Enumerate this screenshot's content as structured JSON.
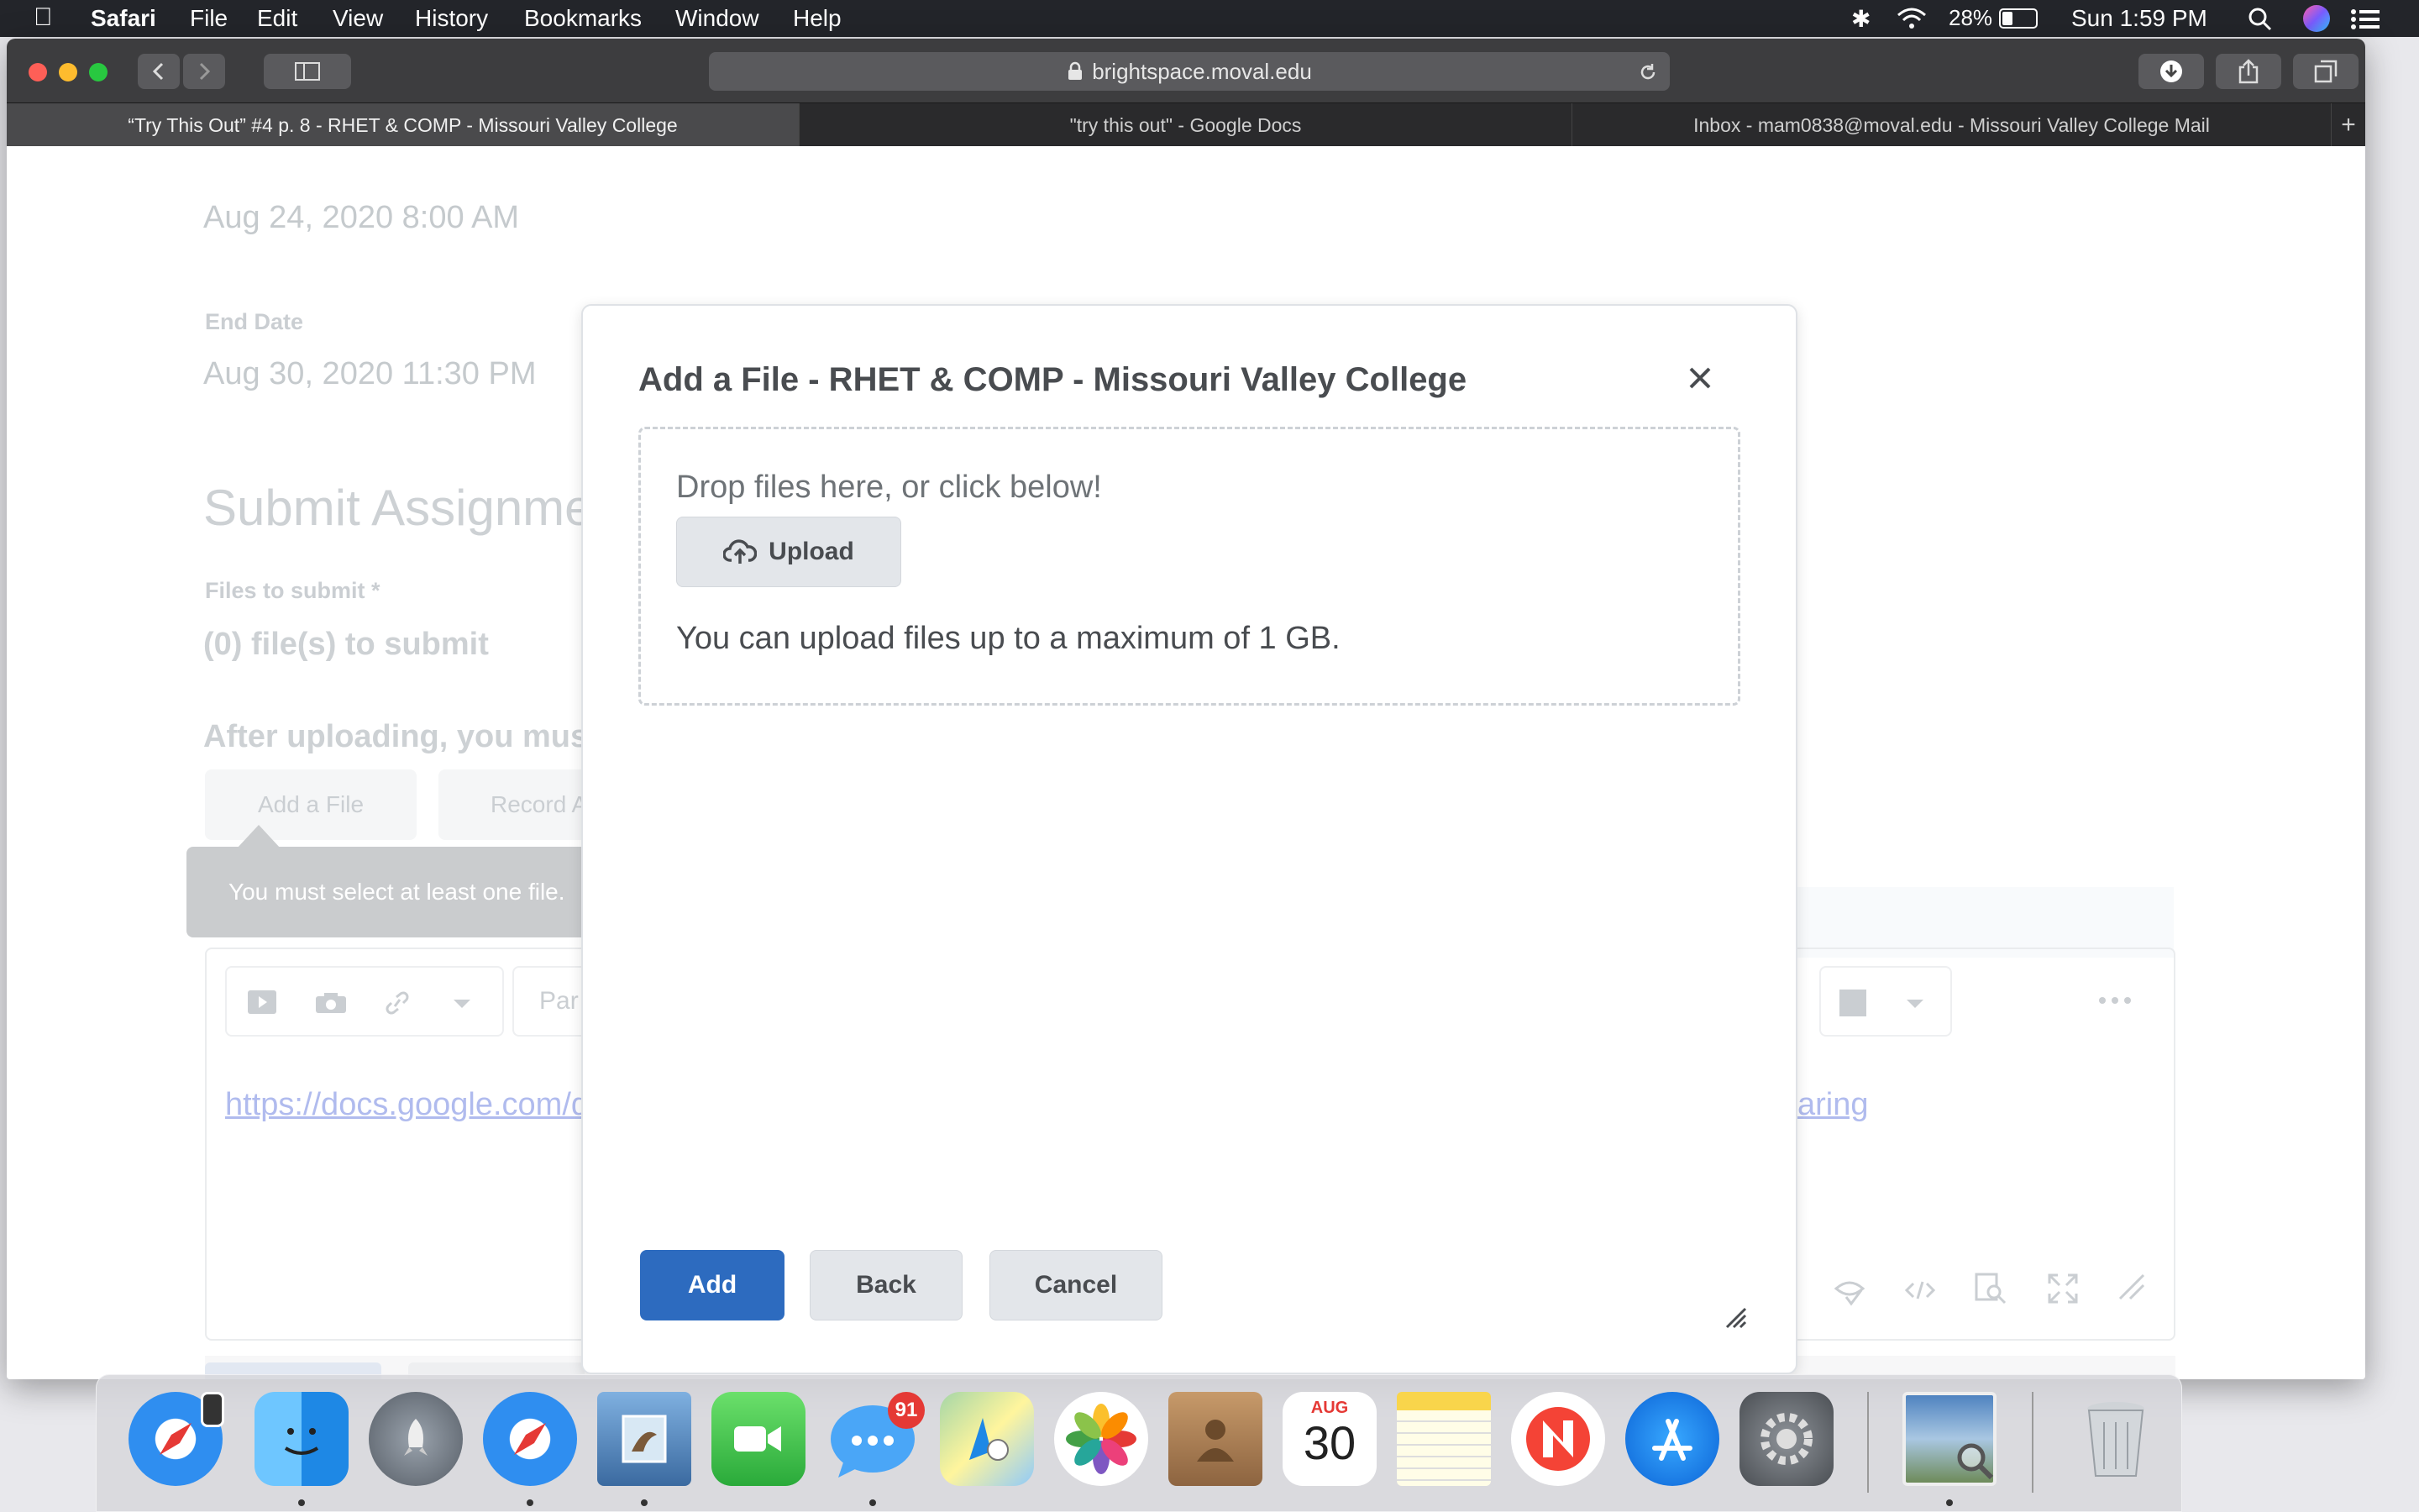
{
  "menubar": {
    "app_name": "Safari",
    "items": [
      "File",
      "Edit",
      "View",
      "History",
      "Bookmarks",
      "Window",
      "Help"
    ],
    "battery": "28%",
    "clock": "Sun 1:59 PM"
  },
  "browser": {
    "url": "brightspace.moval.edu",
    "tabs": [
      {
        "title": "“Try This Out” #4 p. 8 - RHET & COMP - Missouri Valley College"
      },
      {
        "title": "\"try this out\" - Google Docs"
      },
      {
        "title": "Inbox - mam0838@moval.edu - Missouri Valley College Mail"
      }
    ],
    "new_tab": "+"
  },
  "page": {
    "start_date": "Aug 24, 2020 8:00 AM",
    "end_date_label": "End Date",
    "end_date": "Aug 30, 2020 11:30 PM",
    "section_heading": "Submit Assignme",
    "files_label": "Files to submit *",
    "files_count": "(0) file(s) to submit",
    "after_upload": "After uploading, you must",
    "add_file_button": "Add a File",
    "record_button": "Record A",
    "tooltip": "You must select at least one file.",
    "editor_format_placeholder": "Par",
    "link_left": "https://docs.google.com/d",
    "link_right": "aring"
  },
  "modal": {
    "title": "Add a File - RHET & COMP - Missouri Valley College",
    "drop_text": "Drop files here, or click below!",
    "upload_label": "Upload",
    "limit_text": "You can upload files up to a maximum of 1 GB.",
    "add_label": "Add",
    "back_label": "Back",
    "cancel_label": "Cancel"
  },
  "dock": {
    "messages_badge": "91",
    "calendar_month": "AUG",
    "calendar_day": "30"
  },
  "colors": {
    "primary_button": "#2d6bbf",
    "menubar": "#23252a",
    "toolbar": "#3d3d3f"
  }
}
